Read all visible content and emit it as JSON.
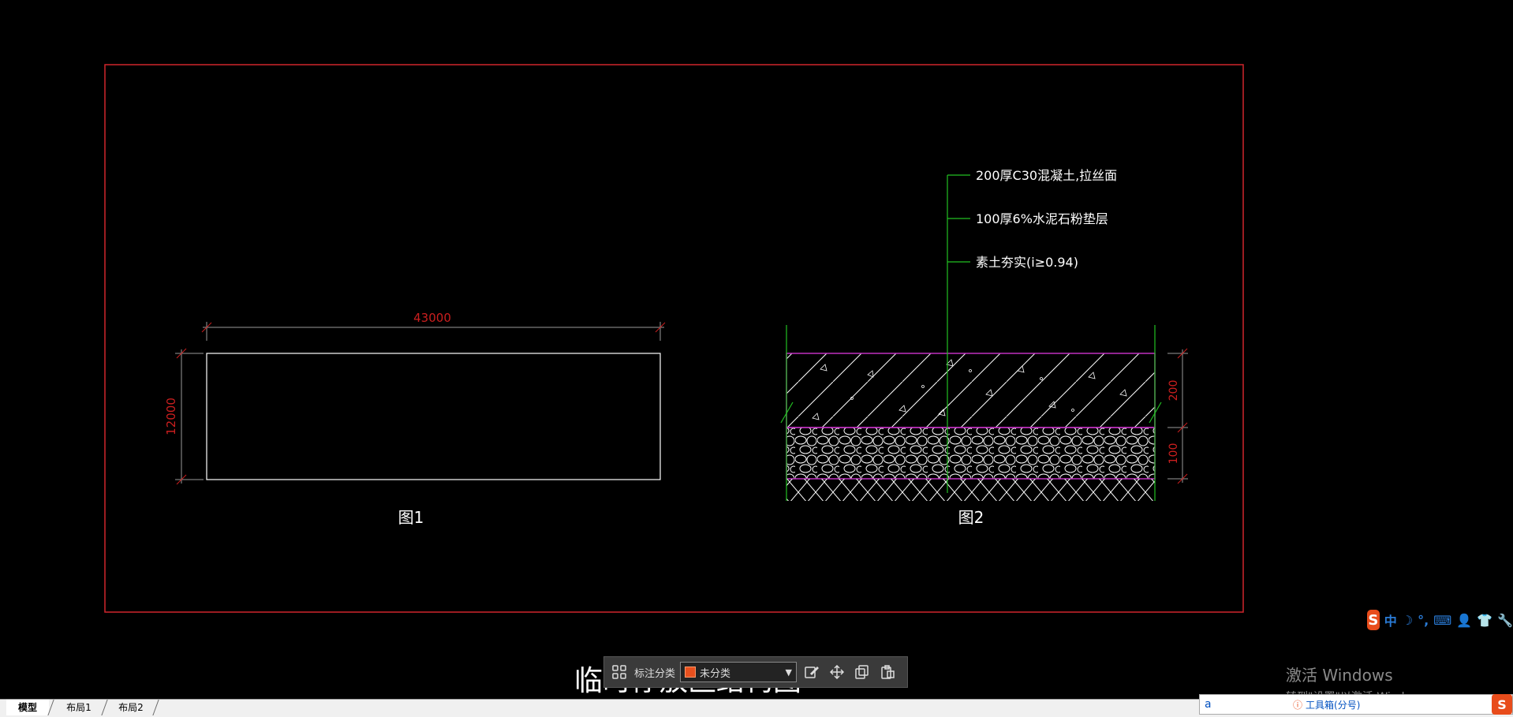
{
  "drawing": {
    "fig1": {
      "caption": "图1",
      "dim_width": "43000",
      "dim_height": "12000"
    },
    "fig2": {
      "caption": "图2",
      "layer1_label": "200厚C30混凝土,拉丝面",
      "layer2_label": "100厚6%水泥石粉垫层",
      "layer3_label": "素土夯实(i≥0.94)",
      "dim_200": "200",
      "dim_100": "100"
    },
    "sheet_title": "临时停放区结构图"
  },
  "layout_tabs": [
    {
      "label": "模型",
      "active": true
    },
    {
      "label": "布局1",
      "active": false
    },
    {
      "label": "布局2",
      "active": false
    }
  ],
  "annotation_toolbar": {
    "category_label": "标注分类",
    "category_value": "未分类",
    "swatch_color": "#e8501e",
    "icons": [
      "grid-icon",
      "edit-icon",
      "move-icon",
      "copy-icon",
      "paste-icon"
    ]
  },
  "watermark": {
    "line1": "激活 Windows",
    "line2": "转到\"设置\"以激活 Windows。"
  },
  "ime": {
    "logo": "S",
    "items": [
      "中",
      "☽",
      "°,",
      "⌨",
      "👤",
      "👕",
      "🔧"
    ]
  },
  "command": {
    "input_value": "a",
    "hint": "工具箱(分号)",
    "hint_icon": "ⓘ",
    "corner_logo": "S"
  },
  "colors": {
    "frame": "#d0262c",
    "dimension": "#cc1f1f",
    "layer_border": "#c030c0",
    "leader": "#22c022",
    "linework": "#ffffff"
  }
}
